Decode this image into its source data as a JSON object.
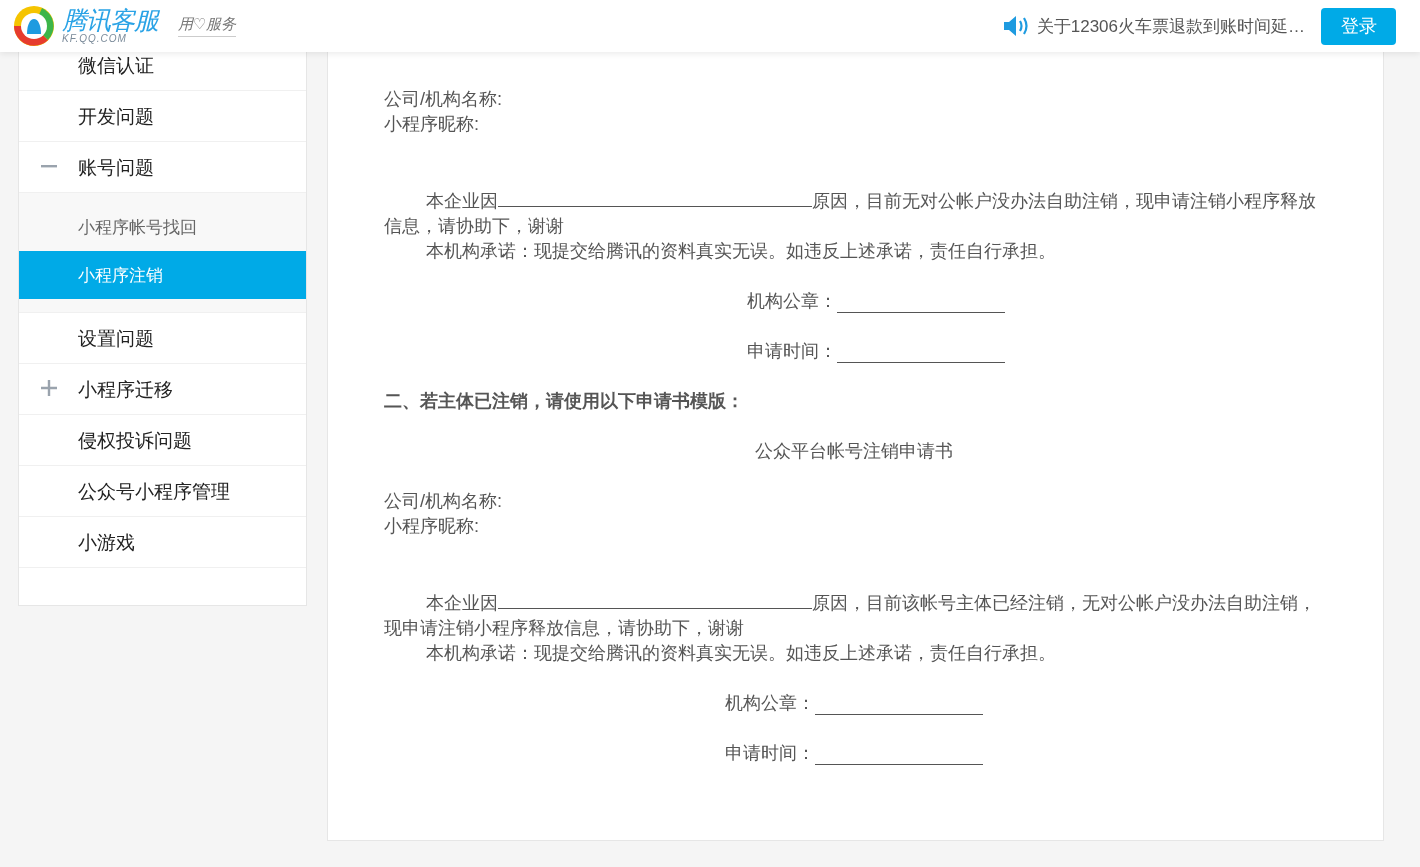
{
  "header": {
    "logo_text": "腾讯客服",
    "logo_domain": "KF.QQ.COM",
    "slogan": "用♡服务",
    "notice": "关于12306火车票退款到账时间延…",
    "login_button": "登录"
  },
  "sidebar": {
    "items": [
      {
        "label": "微信认证",
        "expandable": false
      },
      {
        "label": "开发问题",
        "expandable": false
      },
      {
        "label": "账号问题",
        "expandable": true,
        "expanded": true,
        "children": [
          {
            "label": "小程序帐号找回",
            "selected": false
          },
          {
            "label": "小程序注销",
            "selected": true
          }
        ]
      },
      {
        "label": "设置问题",
        "expandable": false
      },
      {
        "label": "小程序迁移",
        "expandable": true,
        "expanded": false
      },
      {
        "label": "侵权投诉问题",
        "expandable": false
      },
      {
        "label": "公众号小程序管理",
        "expandable": false
      },
      {
        "label": "小游戏",
        "expandable": false
      }
    ]
  },
  "document": {
    "sections": [
      {
        "fields": [
          "公司/机构名称:",
          "小程序昵称:"
        ],
        "paragraphs": [
          {
            "parts": [
              "本企业因",
              "原因，目前无对公帐户没办法自助注销，现申请注销小程序释放信息，请协助下，谢谢"
            ]
          },
          {
            "parts": [
              "本机构承诺：现提交给腾讯的资料真实无误。如违反上述承诺，责任自行承担。"
            ]
          }
        ],
        "signatures": [
          "机构公章：",
          "申请时间："
        ]
      },
      {
        "heading": "二、若主体已注销，请使用以下申请书模版：",
        "title": "公众平台帐号注销申请书",
        "fields": [
          "公司/机构名称:",
          "小程序昵称:"
        ],
        "paragraphs": [
          {
            "parts": [
              "本企业因",
              "原因，目前该帐号主体已经注销，无对公帐户没办法自助注销，现申请注销小程序释放信息，请协助下，谢谢"
            ]
          },
          {
            "parts": [
              "本机构承诺：现提交给腾讯的资料真实无误。如违反上述承诺，责任自行承担。"
            ]
          }
        ],
        "signatures": [
          "机构公章：",
          "申请时间："
        ]
      }
    ]
  }
}
